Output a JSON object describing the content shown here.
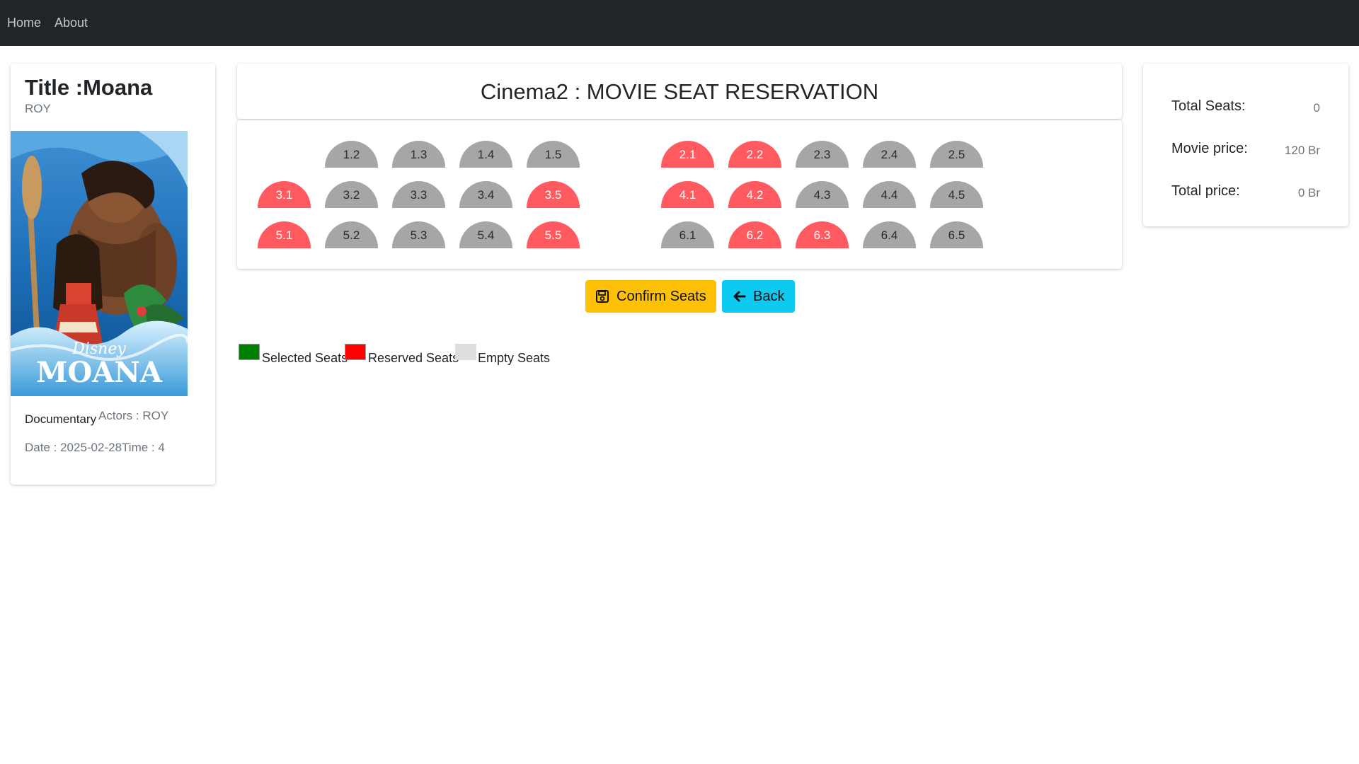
{
  "nav": {
    "home": "Home",
    "about": "About"
  },
  "movie": {
    "title": "Title :Moana",
    "subtitle": "ROY",
    "genre": "Documentary",
    "actors": "Actors : ROY",
    "datetime": "Date : 2025-02-28Time : 4",
    "poster_brand": "Disney",
    "poster_title": "MOANA"
  },
  "header": {
    "title": "Cinema2 : MOVIE SEAT RESERVATION"
  },
  "seats": [
    {
      "label": "1.2",
      "status": "empty"
    },
    {
      "label": "1.3",
      "status": "empty"
    },
    {
      "label": "1.4",
      "status": "empty"
    },
    {
      "label": "1.5",
      "status": "empty"
    },
    {
      "label": "2.1",
      "status": "reserved"
    },
    {
      "label": "2.2",
      "status": "reserved"
    },
    {
      "label": "2.3",
      "status": "empty"
    },
    {
      "label": "2.4",
      "status": "empty"
    },
    {
      "label": "2.5",
      "status": "empty"
    },
    {
      "label": "3.1",
      "status": "reserved"
    },
    {
      "label": "3.2",
      "status": "empty"
    },
    {
      "label": "3.3",
      "status": "empty"
    },
    {
      "label": "3.4",
      "status": "empty"
    },
    {
      "label": "3.5",
      "status": "reserved"
    },
    {
      "label": "4.1",
      "status": "reserved"
    },
    {
      "label": "4.2",
      "status": "reserved"
    },
    {
      "label": "4.3",
      "status": "empty"
    },
    {
      "label": "4.4",
      "status": "empty"
    },
    {
      "label": "4.5",
      "status": "empty"
    },
    {
      "label": "5.1",
      "status": "reserved"
    },
    {
      "label": "5.2",
      "status": "empty"
    },
    {
      "label": "5.3",
      "status": "empty"
    },
    {
      "label": "5.4",
      "status": "empty"
    },
    {
      "label": "5.5",
      "status": "reserved"
    },
    {
      "label": "6.1",
      "status": "empty"
    },
    {
      "label": "6.2",
      "status": "reserved"
    },
    {
      "label": "6.3",
      "status": "reserved"
    },
    {
      "label": "6.4",
      "status": "empty"
    },
    {
      "label": "6.5",
      "status": "empty"
    }
  ],
  "buttons": {
    "confirm": "Confirm Seats",
    "back": "Back",
    "confirm_icon": "floppy-disk-icon",
    "back_icon": "arrow-left-icon"
  },
  "legend": {
    "selected": "Selected Seats",
    "reserved": "Reserved Seats",
    "empty": "Empty Seats"
  },
  "totals": {
    "seats_label": "Total Seats:",
    "seats_value": "0",
    "price_label": "Movie price:",
    "price_value": "120 Br",
    "total_label": "Total price:",
    "total_value": "0 Br"
  },
  "colors": {
    "navbar": "#212529",
    "seat_empty": "#a6a6a6",
    "seat_reserved": "#ff5a5f",
    "legend_selected": "#008000",
    "legend_reserved": "#ff0000",
    "legend_empty": "#dddddd",
    "confirm_button": "#ffc107",
    "back_button": "#0dcaf0"
  }
}
